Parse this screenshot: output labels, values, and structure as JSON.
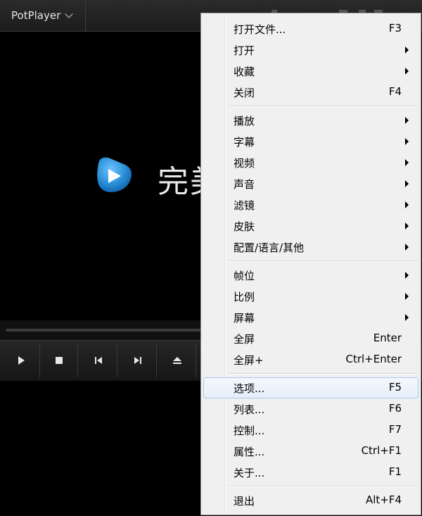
{
  "app": {
    "menu_button_label": "PotPlayer",
    "logo_text": "完美"
  },
  "colors": {
    "logo_blue": "#2a8fd8",
    "menu_bg": "#f0f0f0",
    "highlight_border": "#a8c8ec"
  },
  "controls": [
    {
      "name": "play",
      "icon": "play-icon"
    },
    {
      "name": "stop",
      "icon": "stop-icon"
    },
    {
      "name": "previous",
      "icon": "previous-icon"
    },
    {
      "name": "next",
      "icon": "next-icon"
    },
    {
      "name": "eject",
      "icon": "eject-icon"
    }
  ],
  "context_menu": {
    "items": [
      {
        "label": "打开文件...",
        "shortcut": "F3"
      },
      {
        "label": "打开",
        "submenu": true
      },
      {
        "label": "收藏",
        "submenu": true
      },
      {
        "label": "关闭",
        "shortcut": "F4"
      },
      {
        "separator": true
      },
      {
        "label": "播放",
        "submenu": true
      },
      {
        "label": "字幕",
        "submenu": true
      },
      {
        "label": "视频",
        "submenu": true
      },
      {
        "label": "声音",
        "submenu": true
      },
      {
        "label": "滤镜",
        "submenu": true
      },
      {
        "label": "皮肤",
        "submenu": true
      },
      {
        "label": "配置/语言/其他",
        "submenu": true
      },
      {
        "separator": true
      },
      {
        "label": "帧位",
        "submenu": true
      },
      {
        "label": "比例",
        "submenu": true
      },
      {
        "label": "屏幕",
        "submenu": true
      },
      {
        "label": "全屏",
        "shortcut": "Enter"
      },
      {
        "label": "全屏+",
        "shortcut": "Ctrl+Enter"
      },
      {
        "separator": true
      },
      {
        "label": "选项...",
        "shortcut": "F5",
        "highlighted": true
      },
      {
        "label": "列表...",
        "shortcut": "F6"
      },
      {
        "label": "控制...",
        "shortcut": "F7"
      },
      {
        "label": "属性...",
        "shortcut": "Ctrl+F1"
      },
      {
        "label": "关于...",
        "shortcut": "F1"
      },
      {
        "separator": true
      },
      {
        "label": "退出",
        "shortcut": "Alt+F4"
      }
    ]
  }
}
